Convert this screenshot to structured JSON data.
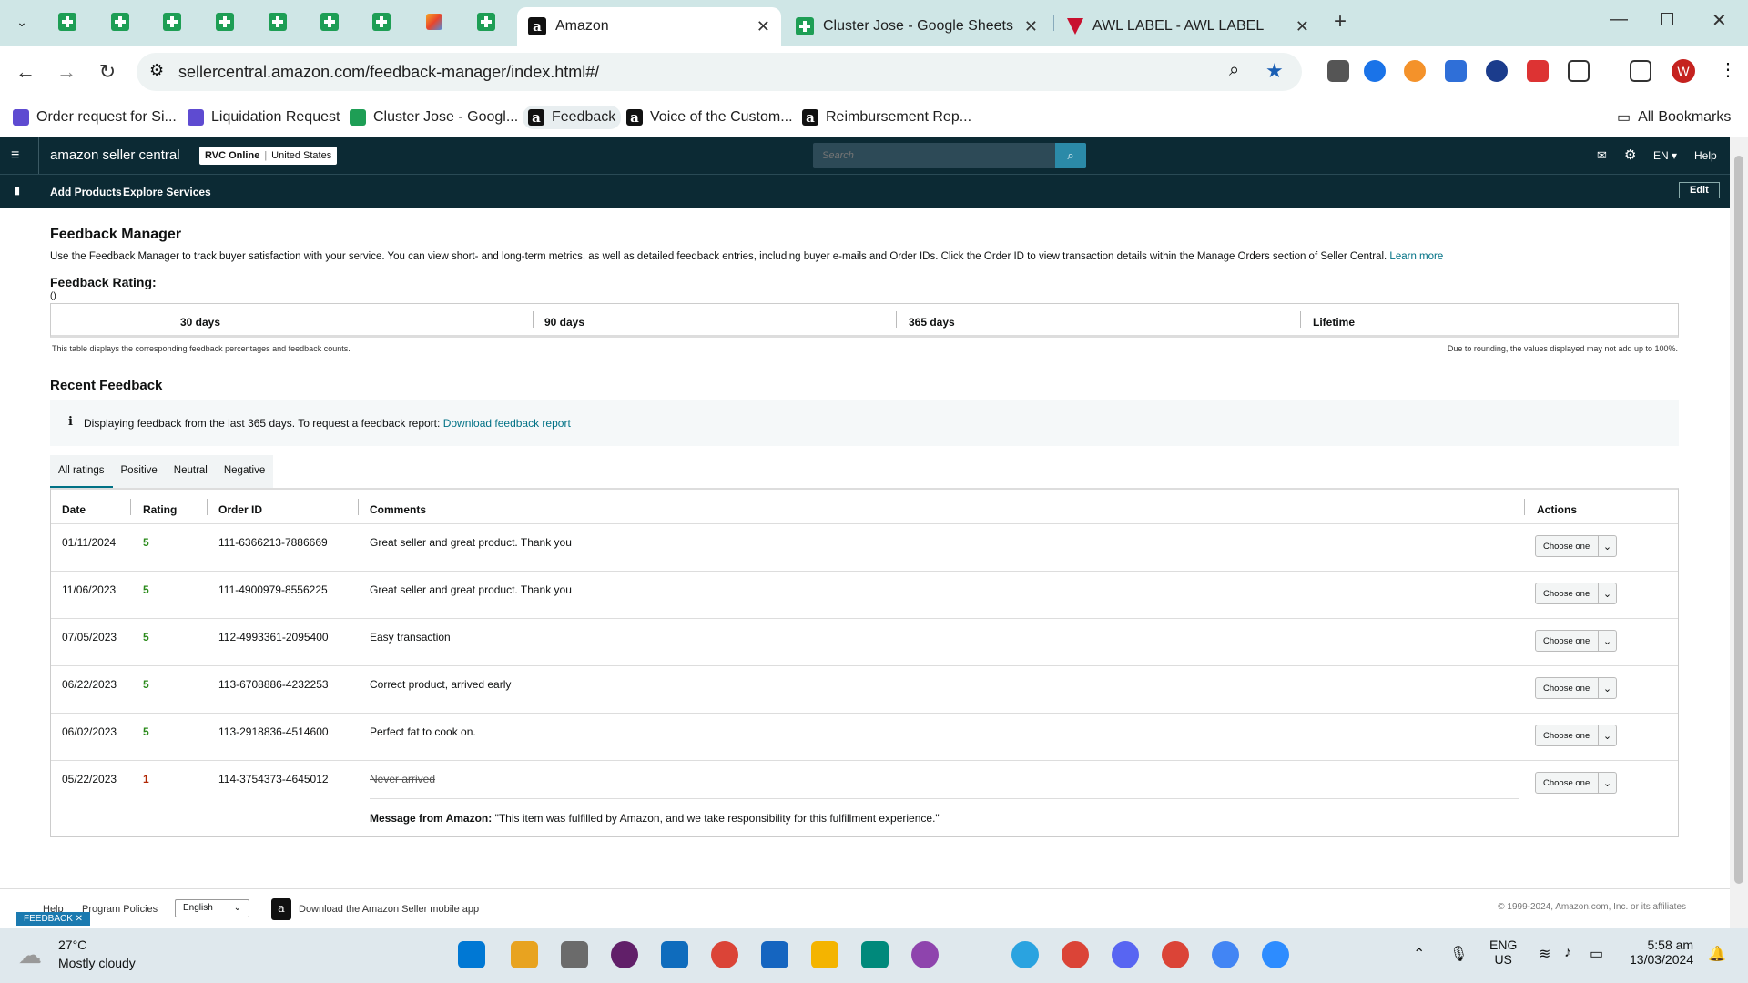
{
  "tabs": {
    "sheets_tab_count": 7,
    "tab_amazon": "Amazon",
    "tab_sheets": "Cluster Jose - Google Sheets",
    "tab_awl": "AWL LABEL - AWL LABEL",
    "new_tab": "+"
  },
  "address": {
    "url": "sellercentral.amazon.com/feedback-manager/index.html#/"
  },
  "bookmarks": {
    "b1": "Order request for Si...",
    "b2": "Liquidation Request",
    "b3": "Cluster Jose - Googl...",
    "b4": "Feedback",
    "b5": "Voice of the Custom...",
    "b6": "Reimbursement Rep...",
    "all": "All Bookmarks"
  },
  "seller": {
    "logo": "amazon seller central",
    "store": "RVC Online",
    "marketplace": "United States",
    "search_placeholder": "Search",
    "lang": "EN",
    "help": "Help",
    "add_products": "Add Products",
    "explore_services": "Explore Services",
    "edit": "Edit"
  },
  "page": {
    "title": "Feedback Manager",
    "description": "Use the Feedback Manager to track buyer satisfaction with your service. You can view short- and long-term metrics, as well as detailed feedback entries, including buyer e-mails and Order IDs. Click the Order ID to view transaction details within the Manage Orders section of Seller Central.",
    "learn_more": "Learn more",
    "rating_heading": "Feedback Rating:",
    "rating_value": "()",
    "col_30": "30 days",
    "col_90": "90 days",
    "col_365": "365 days",
    "col_life": "Lifetime",
    "note_left": "This table displays the corresponding feedback percentages and feedback counts.",
    "note_right": "Due to rounding, the values displayed may not add up to 100%.",
    "recent_heading": "Recent Feedback",
    "info_msg": "Displaying feedback from the last 365 days. To request a feedback report:",
    "download_link": "Download feedback report",
    "tabs": [
      "All ratings",
      "Positive",
      "Neutral",
      "Negative"
    ],
    "headers": {
      "date": "Date",
      "rating": "Rating",
      "order": "Order ID",
      "comments": "Comments",
      "actions": "Actions"
    },
    "action_label": "Choose one",
    "rows": [
      {
        "date": "01/11/2024",
        "rating": "5",
        "order": "111-6366213-7886669",
        "comment": "Great seller and great product. Thank you"
      },
      {
        "date": "11/06/2023",
        "rating": "5",
        "order": "111-4900979-8556225",
        "comment": "Great seller and great product. Thank you"
      },
      {
        "date": "07/05/2023",
        "rating": "5",
        "order": "112-4993361-2095400",
        "comment": "Easy transaction"
      },
      {
        "date": "06/22/2023",
        "rating": "5",
        "order": "113-6708886-4232253",
        "comment": "Correct product, arrived early"
      },
      {
        "date": "06/02/2023",
        "rating": "5",
        "order": "113-2918836-4514600",
        "comment": "Perfect fat to cook on."
      },
      {
        "date": "05/22/2023",
        "rating": "1",
        "order": "114-3754373-4645012",
        "comment": "Never arrived"
      }
    ],
    "amazon_msg_label": "Message from Amazon:",
    "amazon_msg_text": "\"This item was fulfilled by Amazon, and we take responsibility for this fulfillment experience.\""
  },
  "footer": {
    "help": "Help",
    "policies": "Program Policies",
    "language": "English",
    "app": "Download the Amazon Seller mobile app",
    "copyright": "© 1999-2024, Amazon.com, Inc. or its affiliates",
    "feedback_tag": "FEEDBACK"
  },
  "taskbar": {
    "temp": "27°C",
    "weather": "Mostly cloudy",
    "lang1": "ENG",
    "lang2": "US",
    "time": "5:58 am",
    "date": "13/03/2024"
  },
  "colors": {
    "header": "#0c2a34",
    "link": "#007185",
    "positive": "#2a8a1a",
    "negative": "#b12704"
  }
}
